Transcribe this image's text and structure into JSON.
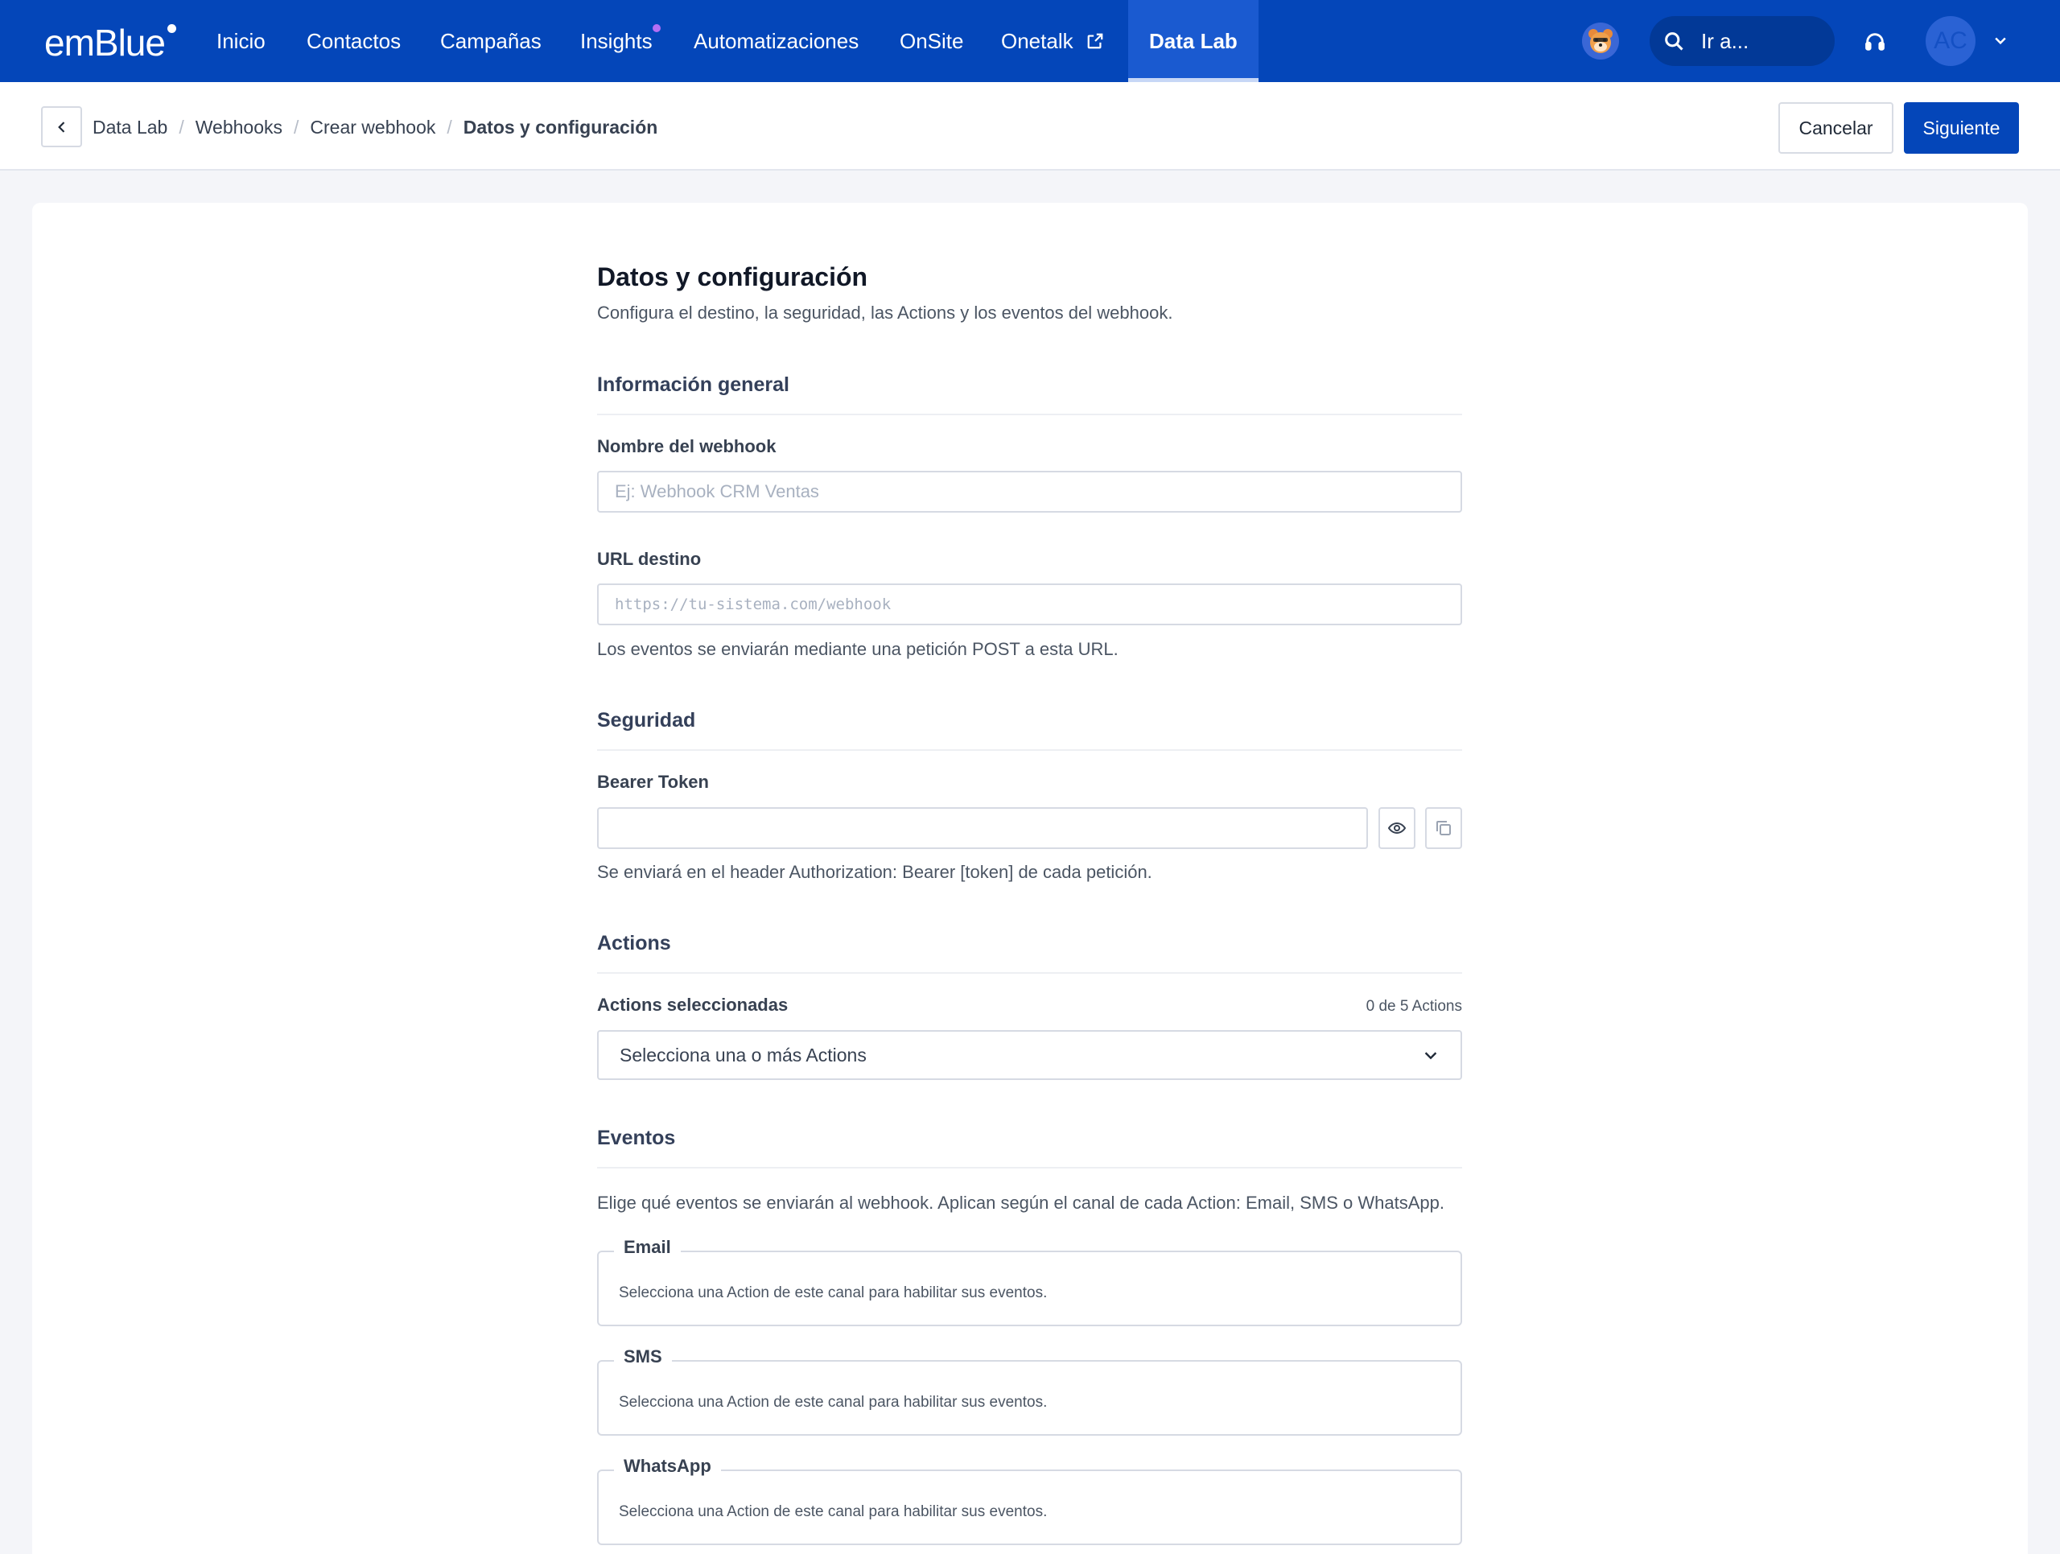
{
  "nav": {
    "logo": "emBlue",
    "items": [
      {
        "label": "Inicio"
      },
      {
        "label": "Contactos"
      },
      {
        "label": "Campañas"
      },
      {
        "label": "Insights"
      },
      {
        "label": "Automatizaciones"
      },
      {
        "label": "OnSite"
      },
      {
        "label": "Onetalk"
      },
      {
        "label": "Data Lab",
        "active": true
      }
    ],
    "search_label": "Ir a...",
    "avatar_initials": "AC",
    "colors": {
      "bar": "#0446b9",
      "badge": "#b46ff5"
    }
  },
  "subheader": {
    "breadcrumb": [
      "Data Lab",
      "Webhooks",
      "Crear webhook",
      "Datos y configuración"
    ],
    "cancel_label": "Cancelar",
    "next_label": "Siguiente"
  },
  "form": {
    "title": "Datos y configuración",
    "description": "Configura el destino, la seguridad, las Actions y los eventos del webhook.",
    "general": {
      "title": "Información general",
      "name_label": "Nombre del webhook",
      "name_placeholder": "Ej: Webhook CRM Ventas",
      "url_label": "URL destino",
      "url_placeholder": "https://tu-sistema.com/webhook",
      "url_help": "Los eventos se enviarán mediante una petición POST a esta URL."
    },
    "security": {
      "title": "Seguridad",
      "token_label": "Bearer Token",
      "token_value": "",
      "token_help": "Se enviará en el header Authorization: Bearer [token] de cada petición."
    },
    "actions": {
      "title": "Actions",
      "selected_label": "Actions seleccionadas",
      "counter": "0 de 5 Actions",
      "select_placeholder": "Selecciona una o más Actions"
    },
    "events": {
      "title": "Eventos",
      "description": "Elige qué eventos se enviarán al webhook. Aplican según el canal de cada Action: Email, SMS o WhatsApp.",
      "channels": [
        {
          "name": "Email",
          "hint": "Selecciona una Action de este canal para habilitar sus eventos."
        },
        {
          "name": "SMS",
          "hint": "Selecciona una Action de este canal para habilitar sus eventos."
        },
        {
          "name": "WhatsApp",
          "hint": "Selecciona una Action de este canal para habilitar sus eventos."
        }
      ]
    }
  }
}
